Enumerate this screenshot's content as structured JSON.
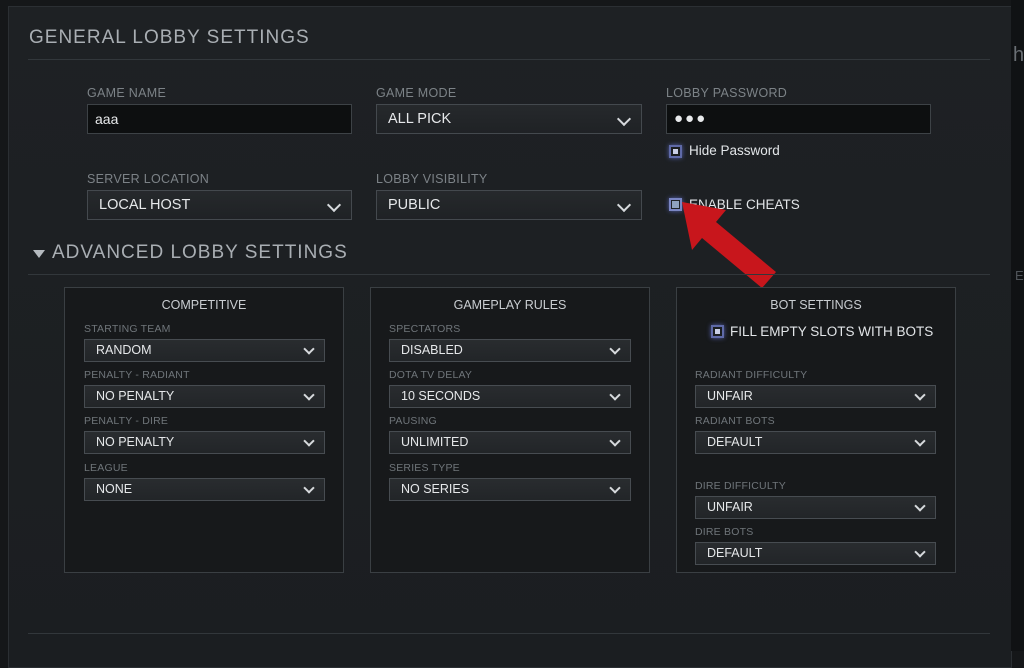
{
  "general": {
    "title": "GENERAL LOBBY SETTINGS",
    "game_name": {
      "label": "GAME NAME",
      "value": "aaa"
    },
    "game_mode": {
      "label": "GAME MODE",
      "value": "ALL PICK"
    },
    "lobby_password": {
      "label": "LOBBY PASSWORD",
      "value": "●●●"
    },
    "hide_password": {
      "label": "Hide Password",
      "checked": true
    },
    "server_location": {
      "label": "SERVER LOCATION",
      "value": "LOCAL HOST"
    },
    "lobby_visibility": {
      "label": "LOBBY VISIBILITY",
      "value": "PUBLIC"
    },
    "enable_cheats": {
      "label": "ENABLE CHEATS",
      "checked": false
    }
  },
  "advanced": {
    "title": "ADVANCED LOBBY SETTINGS",
    "competitive": {
      "title": "COMPETITIVE",
      "starting_team": {
        "label": "STARTING TEAM",
        "value": "RANDOM"
      },
      "penalty_radiant": {
        "label": "PENALTY - RADIANT",
        "value": "NO PENALTY"
      },
      "penalty_dire": {
        "label": "PENALTY - DIRE",
        "value": "NO PENALTY"
      },
      "league": {
        "label": "LEAGUE",
        "value": "NONE"
      }
    },
    "gameplay": {
      "title": "GAMEPLAY RULES",
      "spectators": {
        "label": "SPECTATORS",
        "value": "DISABLED"
      },
      "dota_tv_delay": {
        "label": "DOTA TV DELAY",
        "value": "10 SECONDS"
      },
      "pausing": {
        "label": "PAUSING",
        "value": "UNLIMITED"
      },
      "series_type": {
        "label": "SERIES TYPE",
        "value": "NO SERIES"
      }
    },
    "bots": {
      "title": "BOT SETTINGS",
      "fill_empty": {
        "label": "FILL EMPTY SLOTS WITH BOTS",
        "checked": true
      },
      "radiant_difficulty": {
        "label": "RADIANT DIFFICULTY",
        "value": "UNFAIR"
      },
      "radiant_bots": {
        "label": "RADIANT BOTS",
        "value": "DEFAULT"
      },
      "dire_difficulty": {
        "label": "DIRE DIFFICULTY",
        "value": "UNFAIR"
      },
      "dire_bots": {
        "label": "DIRE BOTS",
        "value": "DEFAULT"
      }
    }
  },
  "edge": {
    "glyph": "h"
  },
  "colors": {
    "accent_checkbox": "#5f6aa8",
    "arrow": "#c8161c",
    "panel_bg": "#1e2124"
  },
  "icons": [
    "chevron-down-icon",
    "triangle-down-icon",
    "red-arrow-annotation"
  ]
}
